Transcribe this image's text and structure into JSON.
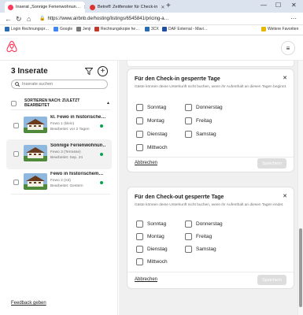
{
  "browser": {
    "tabs": [
      {
        "label": "Inserat „Sonnige Ferienwohnun…",
        "active": true
      },
      {
        "label": "Betreff: Zeitfenster für Check-in",
        "active": false
      }
    ],
    "url": "https://www.airbnb.de/hosting/listings/6545841/pricing-a…",
    "bookmarks": [
      "Login Rechnungspr…",
      "Google",
      "Jenji",
      "Rechnungskopie he…",
      "3CX",
      "DAF External - Mavi…"
    ],
    "bookmarks_right": "Weitere Favoriten"
  },
  "listings_panel": {
    "title": "3 Inserate",
    "search_placeholder": "Inserate suchen",
    "sort_label": "SORTIEREN NACH: ZULETZT BEARBEITET",
    "items": [
      {
        "name": "kl. Fewo in historische…",
        "subtitle": "Fewo 1 (klein)",
        "edited": "Bearbeitet: vor 2 Tagen",
        "selected": false
      },
      {
        "name": "Sonnige Ferienwohnun…",
        "subtitle": "Fewo 3 (Terrasse)",
        "edited": "Bearbeitet: Sep. 24",
        "selected": true
      },
      {
        "name": "Fewo in historischem…",
        "subtitle": "Fewo 2 (rot)",
        "edited": "Bearbeitet: Gestern",
        "selected": false
      }
    ],
    "feedback_label": "Feedback geben"
  },
  "checkin_card": {
    "title": "Für den Check-in gesperrte Tage",
    "description": "Gäste können deine Unterkunft nicht buchen, wenn ihr Aufenthalt an diesen Tagen beginnt.",
    "days_col1": [
      "Sonntag",
      "Montag",
      "Dienstag",
      "Mittwoch"
    ],
    "days_col2": [
      "Donnerstag",
      "Freitag",
      "Samstag"
    ],
    "cancel_label": "Abbrechen",
    "save_label": "Speichern"
  },
  "checkout_card": {
    "title": "Für den Check-out gesperrte Tage",
    "description": "Gäste können deine Unterkunft nicht buchen, wenn ihr Aufenthalt an diesen Tagen endet.",
    "days_col1": [
      "Sonntag",
      "Montag",
      "Dienstag",
      "Mittwoch"
    ],
    "days_col2": [
      "Donnerstag",
      "Freitag",
      "Samstag"
    ],
    "cancel_label": "Abbrechen",
    "save_label": "Speichern"
  },
  "colors": {
    "brand": "#ff385c",
    "status_active": "#00a651",
    "disabled_button": "#dddddd"
  }
}
